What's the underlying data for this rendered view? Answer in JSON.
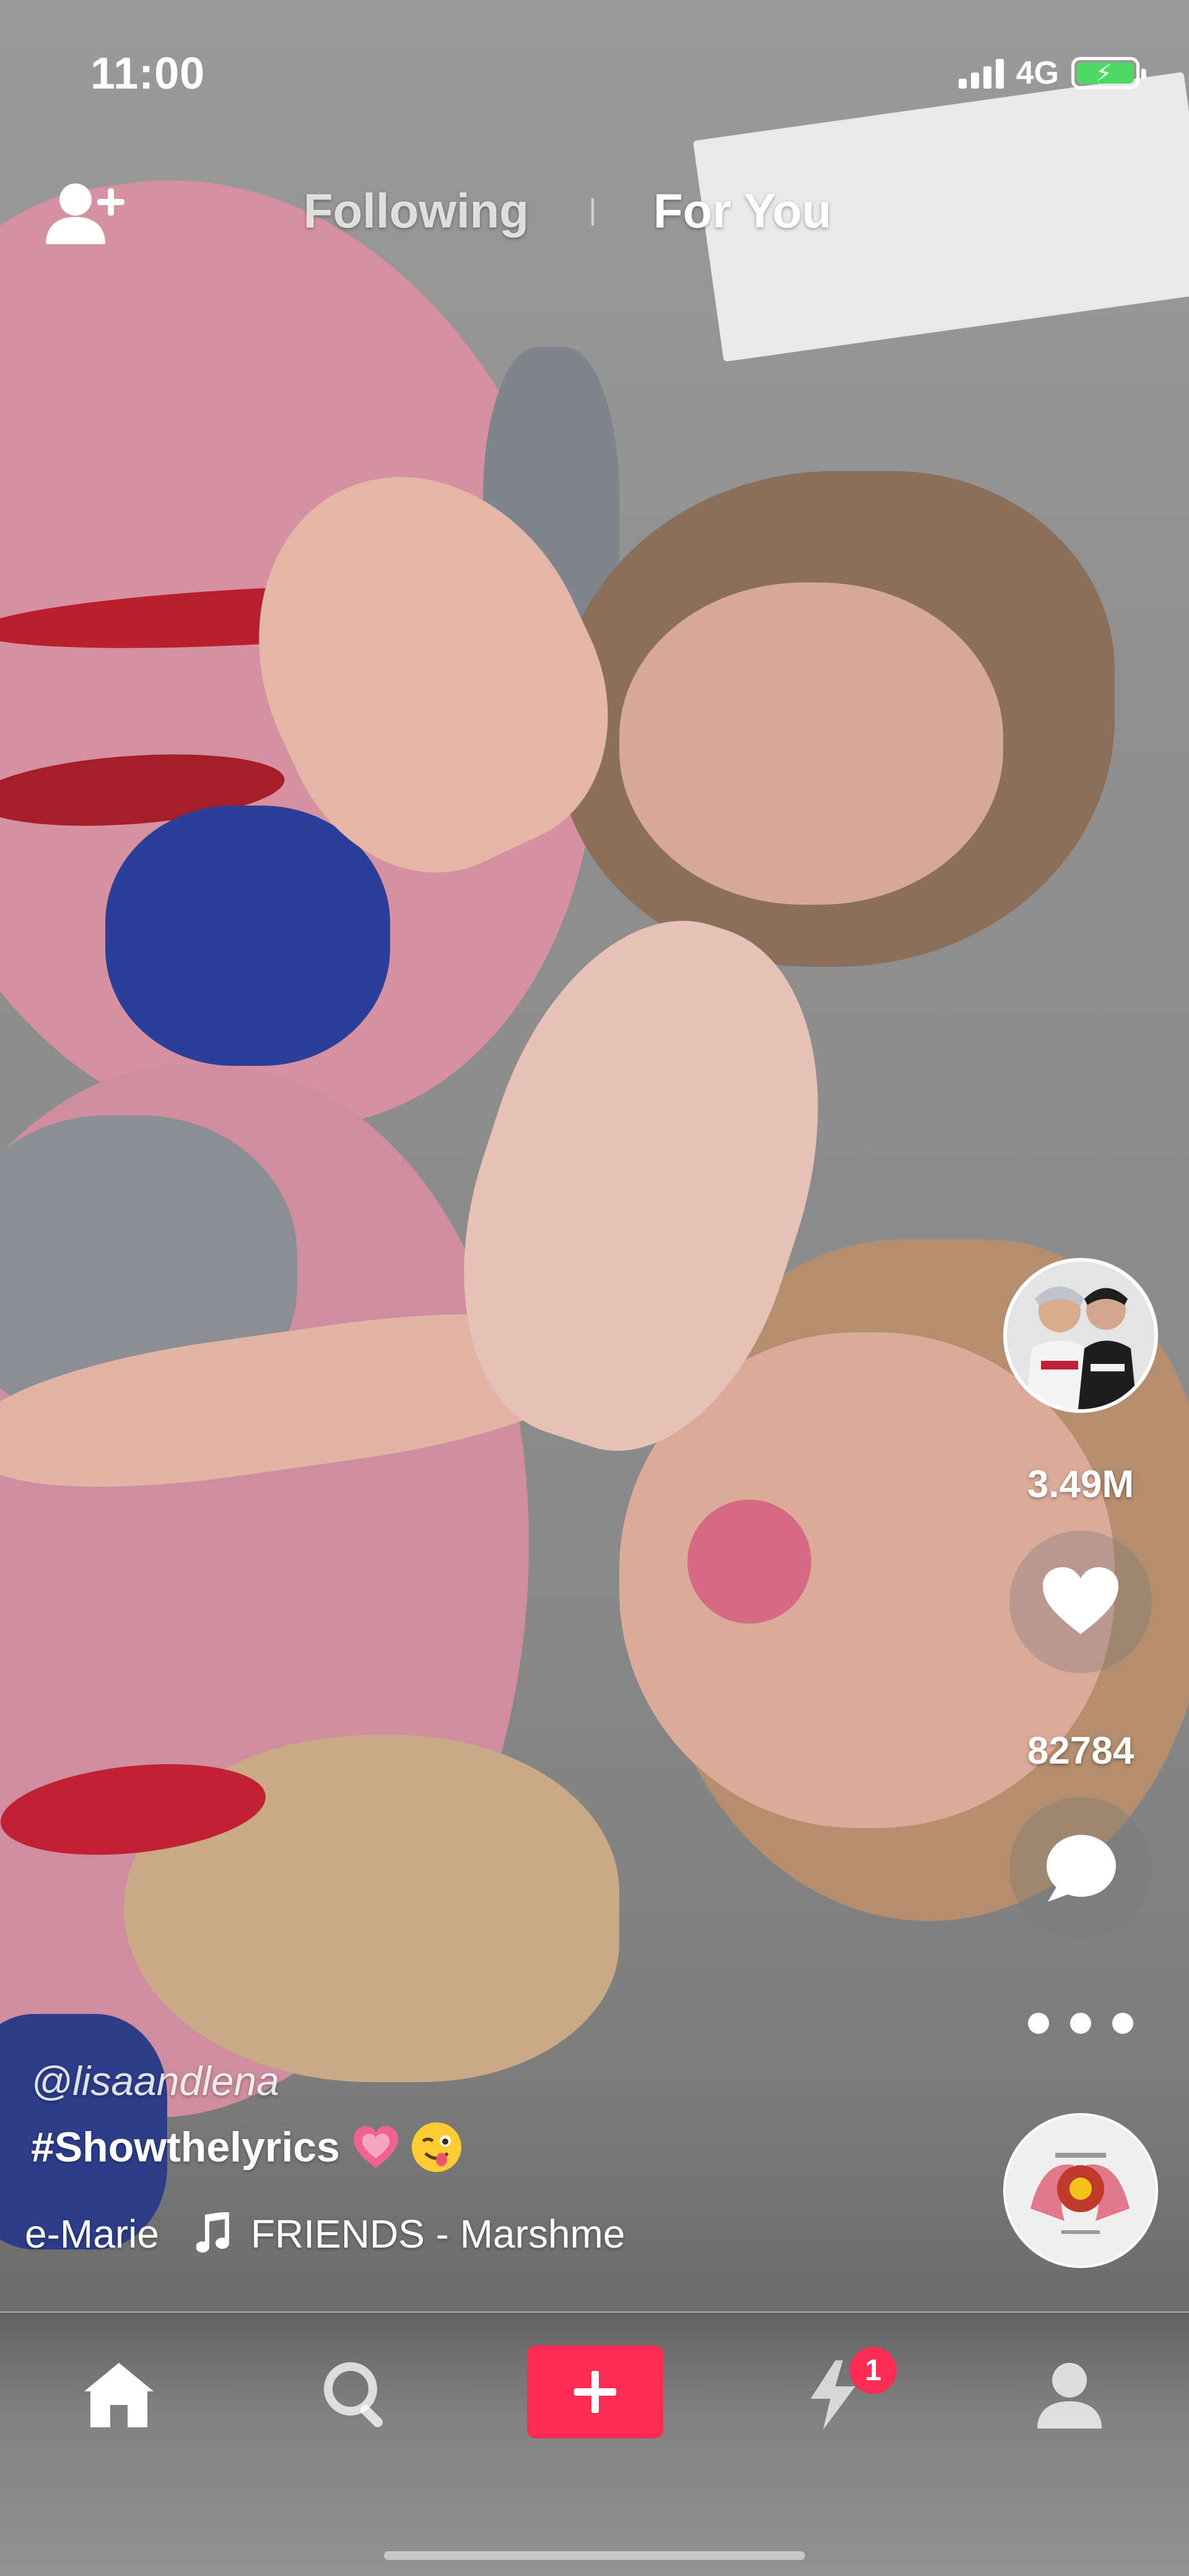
{
  "status_bar": {
    "time": "11:00",
    "network": "4G",
    "battery_level": 1.0
  },
  "top_nav": {
    "tabs": [
      {
        "label": "Following",
        "active": false
      },
      {
        "label": "For You",
        "active": true
      }
    ],
    "icons": {
      "left": "add-friend-icon"
    }
  },
  "right_rail": {
    "likes_count": "3.49M",
    "comments_count": "82784",
    "icons": [
      "creator-avatar",
      "heart-icon",
      "comment-icon",
      "share-icon",
      "music-disc"
    ]
  },
  "caption": {
    "username": "@lisaandlena",
    "hashtag": "#Showthelyrics",
    "emojis": [
      "growing-heart-emoji",
      "winking-tongue-emoji"
    ],
    "music_prefix": "e-Marie",
    "music_title": "FRIENDS - Marshme"
  },
  "bottom_tabs": {
    "items": [
      "home-icon",
      "discover-icon",
      "create-icon",
      "inbox-icon",
      "profile-icon"
    ],
    "inbox_badge": "1"
  },
  "colors": {
    "accent": "#fe2c55",
    "battery_charging": "#4cd964"
  }
}
